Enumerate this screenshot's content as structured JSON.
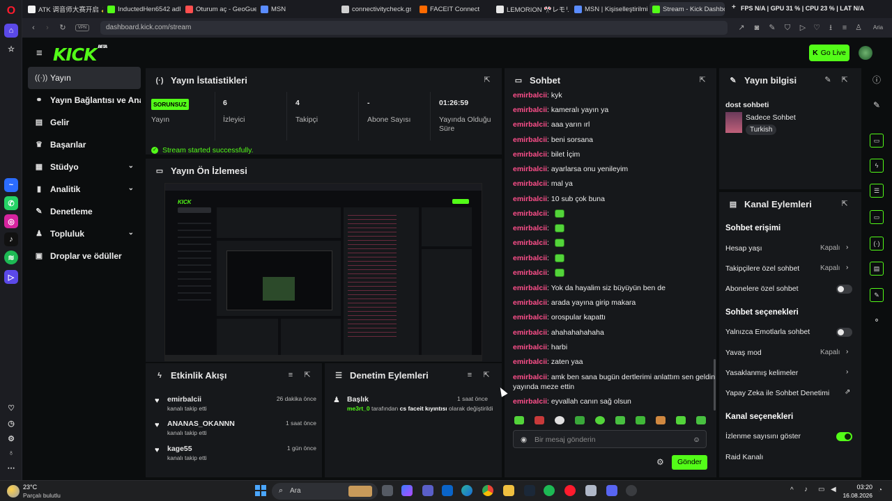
{
  "browser": {
    "tabs": [
      {
        "label": "ATK 调音师大赛开启 ✨ -",
        "color": "#f3f3f3"
      },
      {
        "label": "InductedHen6542 adlı kişi",
        "color": "#53fc18"
      },
      {
        "label": "Oturum aç - GeoGuessr",
        "color": "#ff4f4f"
      },
      {
        "label": "MSN",
        "color": "#5a8cff"
      },
      {
        "label": "connectivitycheck.gstatic.",
        "color": "#d0d0d0"
      },
      {
        "label": "FACEIT Connect",
        "color": "#ff6a00"
      },
      {
        "label": "LEMORION 🎌レモリオン (@",
        "color": "#e8e8e8"
      },
      {
        "label": "MSN | Kişiselleştirilmiş Ha",
        "color": "#5a8cff"
      },
      {
        "label": "Stream - Kick Dashboard",
        "color": "#53fc18"
      }
    ],
    "perf": "FPS  N/A   |   GPU 31 %   |   CPU 23 %   |   LAT N/A",
    "vpn": "VPN",
    "url": "dashboard.kick.com/stream",
    "ai": "Aria"
  },
  "header": {
    "logo": "KICK",
    "beta": "BETA",
    "go_live": "Go Live"
  },
  "nav": [
    {
      "label": "Yayın",
      "icon": "broadcast-icon",
      "glyph": "((·))",
      "chev": ""
    },
    {
      "label": "Yayın Bağlantısı ve Anahtarı",
      "icon": "link-icon",
      "glyph": "⚭",
      "chev": ""
    },
    {
      "label": "Gelir",
      "icon": "revenue-icon",
      "glyph": "▤",
      "chev": ""
    },
    {
      "label": "Başarılar",
      "icon": "trophy-icon",
      "glyph": "♛",
      "chev": ""
    },
    {
      "label": "Stüdyo",
      "icon": "studio-icon",
      "glyph": "▦",
      "chev": "⌄"
    },
    {
      "label": "Analitik",
      "icon": "analytics-icon",
      "glyph": "▮",
      "chev": "⌄"
    },
    {
      "label": "Denetleme",
      "icon": "moderation-icon",
      "glyph": "✎",
      "chev": ""
    },
    {
      "label": "Topluluk",
      "icon": "community-icon",
      "glyph": "♟",
      "chev": "⌄"
    },
    {
      "label": "Droplar ve ödüller",
      "icon": "drops-icon",
      "glyph": "▣",
      "chev": ""
    }
  ],
  "stats": {
    "title": "Yayın İstatistikleri",
    "items": [
      {
        "value": "SORUNSUZ",
        "label": "Yayın"
      },
      {
        "value": "6",
        "label": "İzleyici"
      },
      {
        "value": "4",
        "label": "Takipçi"
      },
      {
        "value": "-",
        "label": "Abone Sayısı"
      },
      {
        "value": "01:26:59",
        "label": "Yayında Olduğu Süre"
      }
    ],
    "success": "Stream started successfully."
  },
  "preview": {
    "title": "Yayın Ön İzlemesi"
  },
  "feed": {
    "title": "Etkinlik Akışı",
    "items": [
      {
        "name": "emirbalcii",
        "sub": "kanalı takip etti",
        "time": "26 dakika önce"
      },
      {
        "name": "ANANAS_OKANNN",
        "sub": "kanalı takip etti",
        "time": "1 saat önce"
      },
      {
        "name": "kage55",
        "sub": "kanalı takip etti",
        "time": "1 gün önce"
      }
    ]
  },
  "modactions": {
    "title": "Denetim Eylemleri",
    "items": [
      {
        "name": "Başlık",
        "time": "1 saat önce",
        "user": "me3rt_0",
        "mid": " tarafından ",
        "value": "cs faceit kıyıntısı",
        "end": " olarak değiştirildi"
      }
    ]
  },
  "chat": {
    "title": "Sohbet",
    "user": "emirbalcii",
    "messages": [
      "kyk",
      "kameralı yayın ya",
      "aaa yarın ırl",
      "beni sorsana",
      "bilet İçim",
      "ayarlarsa onu yenileyim",
      "mal ya",
      "10 sub çok buna",
      "",
      "",
      "",
      "",
      "",
      "Yok da hayalim siz büyüyün ben de",
      "arada yayına girip makara",
      "orospular kapattı",
      "ahahahahahaha",
      "harbi",
      "zaten yaa",
      "amk ben sana bugün dertlerimi anlattım sen geldin",
      "eyvallah canın sağ olsun"
    ],
    "wrap": "yayında meze ettin",
    "placeholder": "Bir mesaj gönderin",
    "send": "Gönder"
  },
  "info": {
    "title": "Yayın bilgisi",
    "stream_title": "dost sohbeti",
    "category": "Sadece Sohbet",
    "language": "Turkish"
  },
  "channel_actions": {
    "title": "Kanal Eylemleri",
    "chat_access": "Sohbet erişimi",
    "account_age": "Hesap yaşı",
    "account_age_val": "Kapalı",
    "followers_only": "Takipçilere özel sohbet",
    "followers_only_val": "Kapalı",
    "subs_only": "Abonelere özel sohbet",
    "chat_options": "Sohbet seçenekleri",
    "emote_only": "Yalnızca Emotlarla sohbet",
    "slow_mode": "Yavaş mod",
    "slow_mode_val": "Kapalı",
    "banned_words": "Yasaklanmış kelimeler",
    "ai_mod": "Yapay Zeka ile Sohbet Denetimi",
    "channel_options": "Kanal seçenekleri",
    "show_viewers": "İzlenme sayısını göster",
    "raid": "Raid Kanalı"
  },
  "taskbar": {
    "temp": "23°C",
    "weather": "Parçalı bulutlu",
    "search": "Ara",
    "time": "03:20",
    "date": "16.08.2026"
  }
}
